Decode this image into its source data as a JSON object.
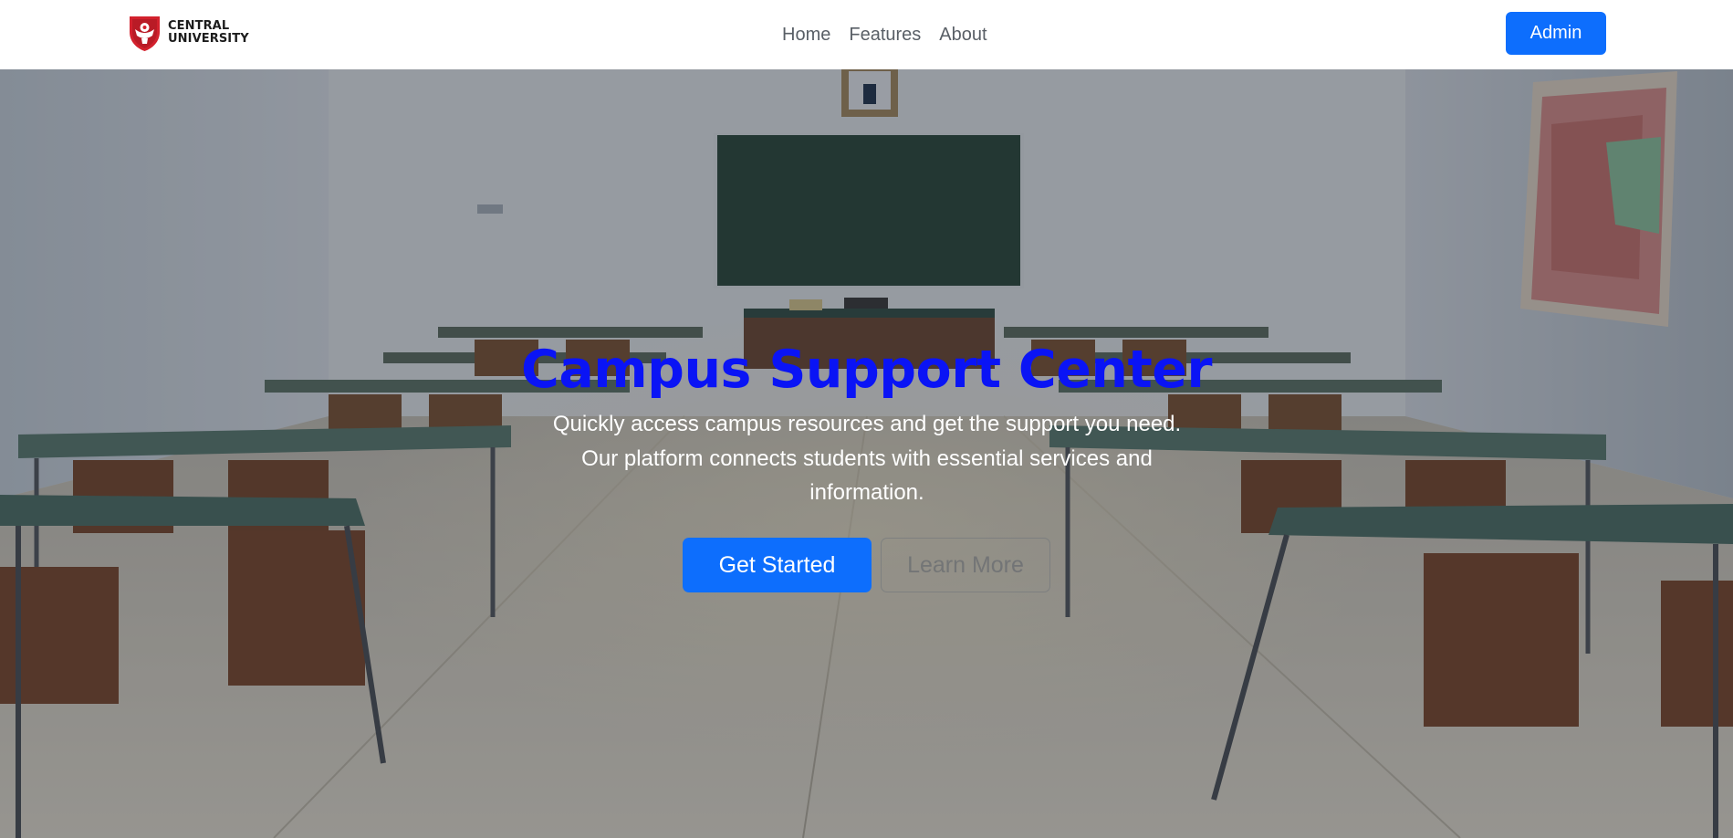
{
  "brand": {
    "line1": "CENTRAL",
    "line2": "UNIVERSITY",
    "icon": "university-shield-logo-icon",
    "color": "#d3212d"
  },
  "nav": {
    "items": [
      {
        "label": "Home"
      },
      {
        "label": "Features"
      },
      {
        "label": "About"
      }
    ],
    "admin_label": "Admin"
  },
  "hero": {
    "background": "classroom-photo",
    "title": "Campus Support Center",
    "title_color": "#0a14f5",
    "text_line1": "Quickly access campus resources and get the support you need.",
    "text_line2": "Our platform connects students with essential services and",
    "text_line3": "information.",
    "primary_label": "Get Started",
    "secondary_label": "Learn More"
  },
  "colors": {
    "accent": "#0d6efd",
    "nav_text": "#595f66"
  }
}
